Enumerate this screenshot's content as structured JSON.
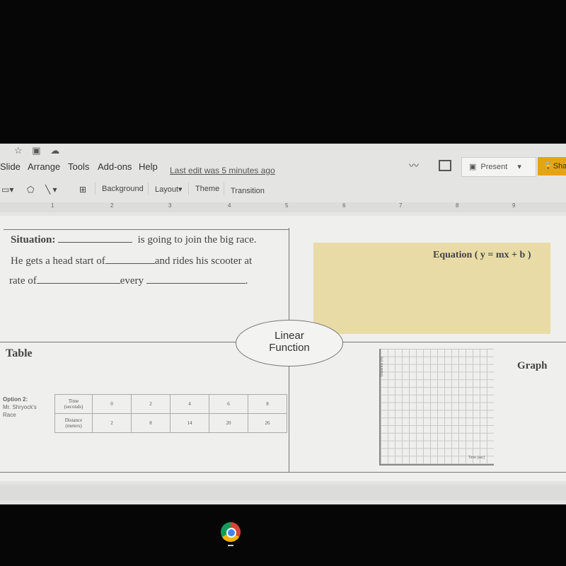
{
  "menu": {
    "items": [
      "Slide",
      "Arrange",
      "Tools",
      "Add-ons",
      "Help"
    ],
    "last_edit": "Last edit was 5 minutes ago",
    "present": "Present",
    "share": "Sha"
  },
  "toolbar": {
    "background": "Background",
    "layout": "Layout",
    "theme": "Theme",
    "transition": "Transition"
  },
  "ruler": [
    "1",
    "2",
    "3",
    "4",
    "5",
    "6",
    "7",
    "8",
    "9"
  ],
  "slide": {
    "situation_label": "Situation:",
    "line1_rest": "is going to join the big race.",
    "line2_a": "He gets a head start of",
    "line2_b": "and rides his scooter at",
    "line3_a": "rate of",
    "line3_b": "every",
    "line3_end": ".",
    "equation_label": "Equation ( y = mx + b )",
    "center_label_1": "Linear",
    "center_label_2": "Function",
    "table_title": "Table",
    "graph_title": "Graph",
    "option_label_1": "Option 2:",
    "option_label_2": "Mr. Shryock's",
    "option_label_3": "Race",
    "table": {
      "rows": [
        {
          "header_1": "Time",
          "header_2": "(seconds)",
          "values": [
            "0",
            "2",
            "4",
            "6",
            "8"
          ]
        },
        {
          "header_1": "Distance",
          "header_2": "(meters)",
          "values": [
            "2",
            "8",
            "14",
            "20",
            "26"
          ]
        }
      ]
    },
    "graph": {
      "y_label": "Distance (m)",
      "x_label": "Time (sec)"
    },
    "equation_box_color": "#e9dba6"
  }
}
